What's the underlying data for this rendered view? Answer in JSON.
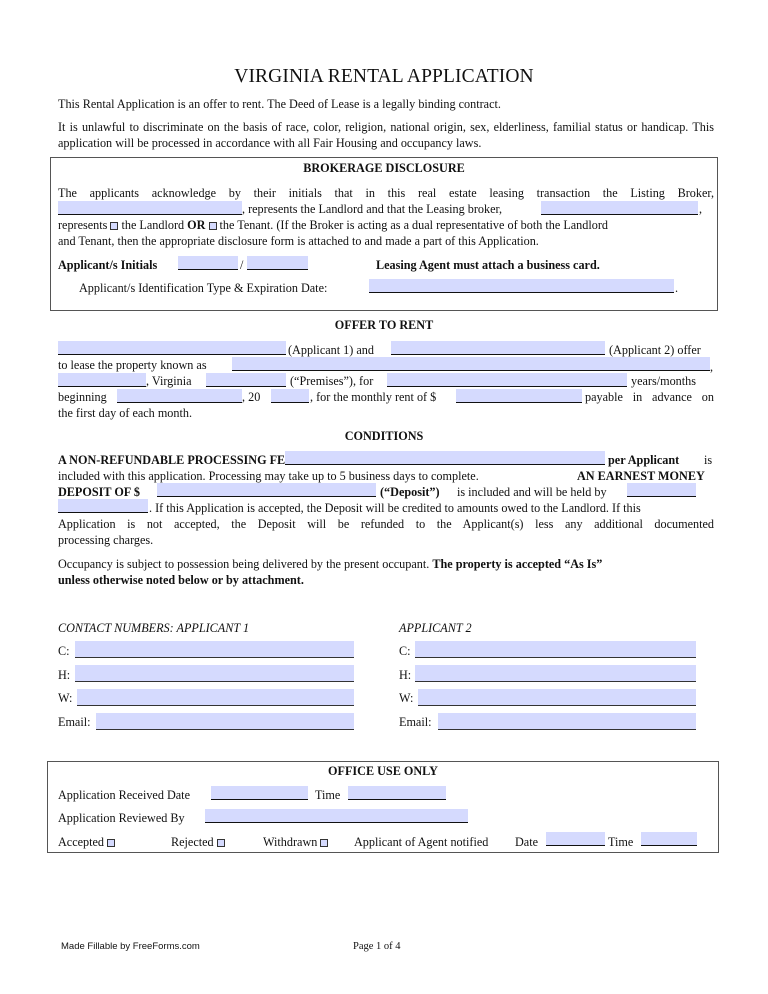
{
  "title": "VIRGINIA RENTAL APPLICATION",
  "intro": {
    "line1": "This Rental Application is an offer to rent. The Deed of Lease is a legally binding contract.",
    "line2": "It is unlawful to discriminate on the basis of race, color, religion, national origin, sex, elderliness, familial status or handicap. This application will be processed in accordance with all Fair Housing and occupancy laws."
  },
  "brokerage": {
    "heading": "BROKERAGE DISCLOSURE",
    "para_start": "The applicants acknowledge by their initials that in this real estate leasing transaction the Listing Broker,",
    "represents_landlord": ", represents the Landlord and that the Leasing broker,",
    "comma": ",",
    "represents": "represents",
    "the_landlord": "the Landlord",
    "or": "OR",
    "the_tenant_rest": "the Tenant. (If the Broker is acting as a dual representative of both the Landlord",
    "line4": "and Tenant, then the appropriate disclosure form is attached to and made a part of this Application.",
    "initials_label": "Applicant/s Initials",
    "slash": "/",
    "business_card": "Leasing Agent must attach a business card.",
    "id_label": "Applicant/s Identification Type & Expiration Date:",
    "period": ".",
    "fields": {
      "listing_broker": "",
      "leasing_broker": "",
      "initials_1": "",
      "initials_2": "",
      "id_type_expiration": ""
    },
    "checkboxes": {
      "landlord": false,
      "tenant": false
    }
  },
  "offer": {
    "heading": "OFFER TO RENT",
    "applicant1_label": "(Applicant 1) and",
    "applicant2_label": "(Applicant 2) offer",
    "lease_property": "to lease the property known as",
    "comma": ",",
    "virginia": ", Virginia",
    "premises": "(“Premises”), for",
    "years_months": "years/months",
    "beginning": "beginning",
    "comma_20": ", 20",
    "monthly_rent": ", for the monthly rent of $",
    "payable": "payable in advance on",
    "first_day": "the first day of each month.",
    "fields": {
      "applicant1": "",
      "applicant2": "",
      "property": "",
      "city": "",
      "zip": "",
      "term": "",
      "begin_date": "",
      "year": "",
      "monthly_rent": ""
    }
  },
  "conditions": {
    "heading": "CONDITIONS",
    "fee_label": "A NON-REFUNDABLE PROCESSING FEE OF $",
    "per_applicant": "per Applicant",
    "is": "is",
    "included_line": "included with this application. Processing may take up to 5 business days to complete.",
    "earnest": "AN EARNEST MONEY",
    "deposit_of": "DEPOSIT OF $",
    "deposit_quote": "(“Deposit”)",
    "held_by": "is included and will be held by",
    "accepted_line": ". If this Application is accepted, the Deposit will be credited to amounts owed to the Landlord. If this",
    "not_accepted_line": "Application is not accepted, the Deposit will be refunded to the Applicant(s) less any additional documented",
    "processing_charges": "processing charges.",
    "occupancy_text": "Occupancy is subject to possession being delivered by the present occupant.",
    "as_is": "The property is accepted “As Is”",
    "unless": "unless otherwise noted below or by attachment.",
    "fields": {
      "fee": "",
      "deposit": "",
      "held_by_1": "",
      "held_by_2": ""
    }
  },
  "contacts": {
    "applicant1_heading": "CONTACT NUMBERS: APPLICANT 1",
    "applicant2_heading": "APPLICANT 2",
    "labels": {
      "c": "C:",
      "h": "H:",
      "w": "W:",
      "email": "Email:"
    },
    "applicant1": {
      "c": "",
      "h": "",
      "w": "",
      "email": ""
    },
    "applicant2": {
      "c": "",
      "h": "",
      "w": "",
      "email": ""
    }
  },
  "office": {
    "heading": "OFFICE USE ONLY",
    "received_date": "Application Received Date",
    "time": "Time",
    "reviewed_by": "Application Reviewed By",
    "accepted": "Accepted",
    "rejected": "Rejected",
    "withdrawn": "Withdrawn",
    "notified": "Applicant of Agent notified",
    "date": "Date",
    "fields": {
      "received_date": "",
      "received_time": "",
      "reviewed_by": "",
      "notified_date": "",
      "notified_time": ""
    },
    "checkboxes": {
      "accepted": false,
      "rejected": false,
      "withdrawn": false
    }
  },
  "footer": {
    "made_fillable": "Made Fillable by FreeForms.com",
    "page": "Page 1 of 4"
  },
  "colors": {
    "field_fill": "#d5dafe",
    "text": "#111111",
    "border": "#555555"
  }
}
